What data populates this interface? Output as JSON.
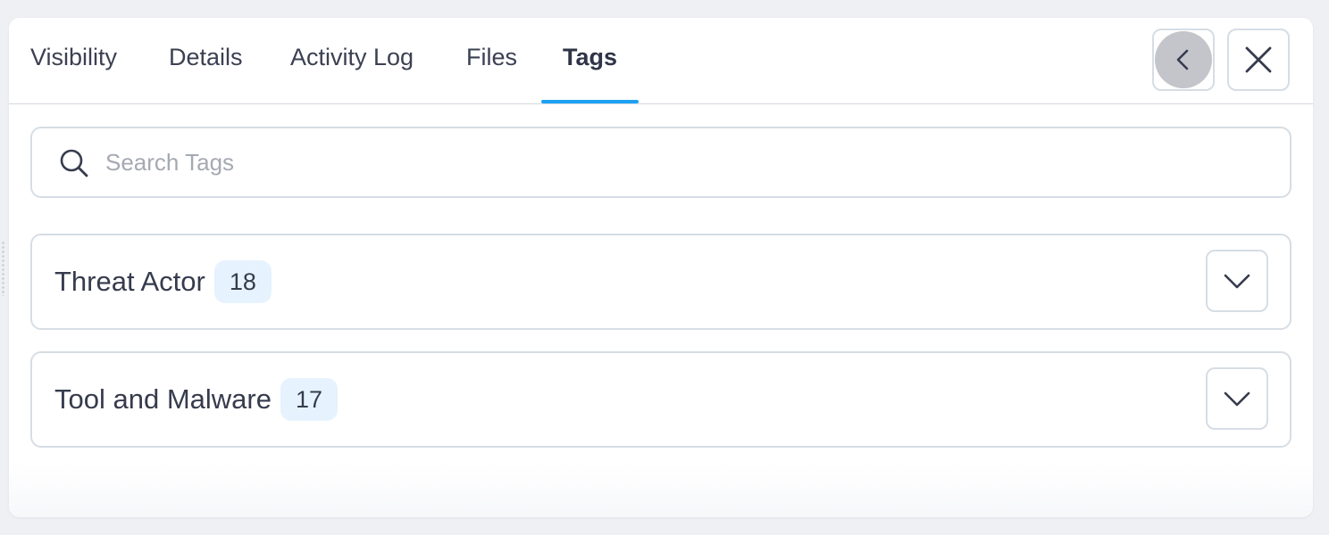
{
  "tabs": [
    {
      "label": "Visibility",
      "active": false
    },
    {
      "label": "Details",
      "active": false
    },
    {
      "label": "Activity Log",
      "active": false
    },
    {
      "label": "Files",
      "active": false
    },
    {
      "label": "Tags",
      "active": true
    }
  ],
  "header": {
    "back_icon": "chevron-left-icon",
    "close_icon": "close-icon"
  },
  "search": {
    "placeholder": "Search Tags",
    "value": "",
    "icon": "search-icon"
  },
  "groups": [
    {
      "title": "Threat Actor",
      "count": "18",
      "icon": "chevron-down-icon"
    },
    {
      "title": "Tool and Malware",
      "count": "17",
      "icon": "chevron-down-icon"
    }
  ],
  "colors": {
    "accent": "#1ea1f3",
    "text": "#363b4d",
    "border": "#d6dde4",
    "badge_bg": "#e6f3fe",
    "back_button_fill": "#c4c5cb"
  }
}
